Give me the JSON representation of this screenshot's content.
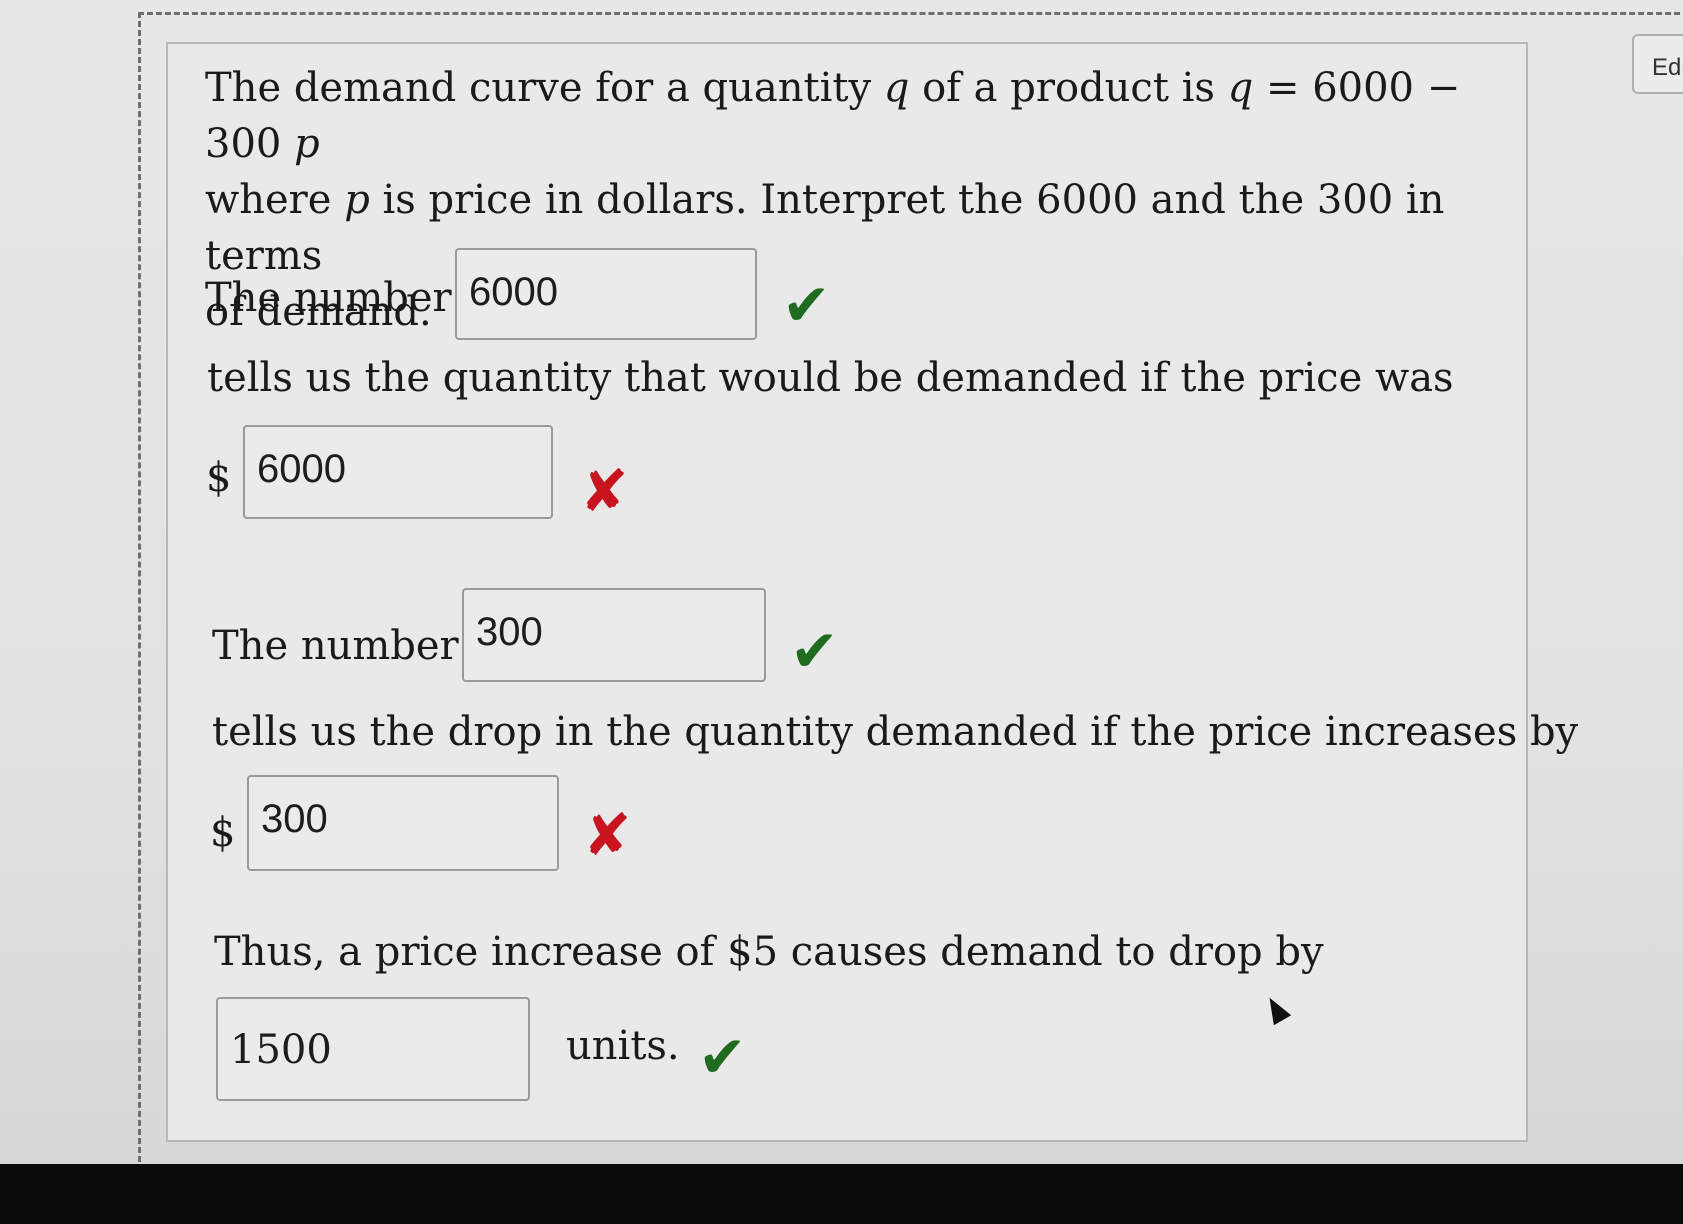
{
  "edit_label": "Edi",
  "prompt": {
    "line1_a": "The demand curve for a quantity ",
    "var_q": "q",
    "line1_b": " of a product is ",
    "eq_q": "q",
    "eq_rest": " = 6000 − 300 ",
    "eq_p": "p",
    "line2_a": "where ",
    "var_p": "p",
    "line2_b": " is price in dollars. Interpret the 6000 and the 300 in terms",
    "line3": "of demand."
  },
  "q1": {
    "label": "The number",
    "answer": "6000",
    "status": "correct",
    "followup": "tells us the quantity that would be demanded if the price was"
  },
  "q2": {
    "currency": "$",
    "answer": "6000",
    "status": "incorrect"
  },
  "q3": {
    "label": "The number",
    "answer": "300",
    "status": "correct",
    "followup": "tells us the drop in the quantity demanded if the price increases by"
  },
  "q4": {
    "currency": "$",
    "answer": "300",
    "status": "incorrect"
  },
  "q5": {
    "text": "Thus, a price increase of $5 causes demand to drop by",
    "answer": "1500",
    "unit": "units.",
    "status": "correct"
  },
  "marks": {
    "check_glyph": "✔",
    "cross_glyph": "✘",
    "check_color": "#1f6b1f",
    "cross_color": "#c8141e"
  }
}
